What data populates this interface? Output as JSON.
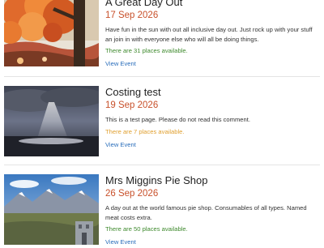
{
  "colors": {
    "date": "#c8502a",
    "available_ok": "#3f8a2e",
    "available_low": "#e0a030",
    "link": "#2a6ebb"
  },
  "events": [
    {
      "title": "A Great Day Out",
      "date": "17 Sep 2026",
      "description": "Have fun in the sun with out all inclusive day out. Just rock up with your stuff an join in with everyone else who will all be doing things.",
      "availability": "There are 31 places available.",
      "availability_status": "ok",
      "link_label": "View Event",
      "image": "autumn-tree-photo"
    },
    {
      "title": "Costing test",
      "date": "19 Sep 2026",
      "description": "This is a test page. Please do not read this comment.",
      "availability": "There are 7 places available.",
      "availability_status": "low",
      "link_label": "View Event",
      "image": "stormy-sea-sunrays-photo"
    },
    {
      "title": "Mrs Miggins Pie Shop",
      "date": "26 Sep 2026",
      "description": "A day out at the world famous pie shop. Consumables of all types. Named meat costs extra.",
      "availability": "There are 50 places available.",
      "availability_status": "ok",
      "link_label": "View Event",
      "image": "mountain-valley-photo"
    }
  ]
}
